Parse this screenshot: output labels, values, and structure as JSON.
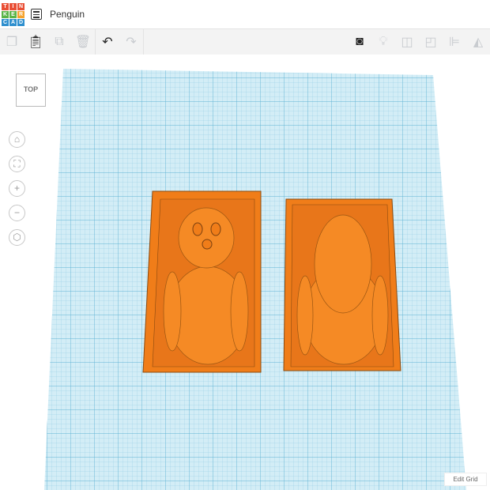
{
  "app": {
    "logo_letters": [
      "T",
      "I",
      "N",
      "K",
      "E",
      "R",
      "C",
      "A",
      "D"
    ],
    "logo_colors": [
      "#e94f35",
      "#e94f35",
      "#e94f35",
      "#5ab448",
      "#5ab448",
      "#f4a22d",
      "#2e8fce",
      "#2e8fce",
      "#2e8fce"
    ],
    "title": "Penguin"
  },
  "toolbar": {
    "left": [
      {
        "icon": "copy-icon",
        "label": "Copy"
      },
      {
        "icon": "paste-icon",
        "label": "Paste"
      },
      {
        "icon": "duplicate-icon",
        "label": "Duplicate"
      },
      {
        "icon": "delete-icon",
        "label": "Delete"
      },
      {
        "icon": "undo-icon",
        "label": "Undo"
      },
      {
        "icon": "redo-icon",
        "label": "Redo"
      }
    ],
    "right": [
      {
        "icon": "note-icon"
      },
      {
        "icon": "lightbulb-icon"
      },
      {
        "icon": "group-icon"
      },
      {
        "icon": "ungroup-icon"
      },
      {
        "icon": "align-icon"
      },
      {
        "icon": "mirror-icon"
      }
    ]
  },
  "view": {
    "cube_label": "TOP",
    "controls": [
      "home-icon",
      "fit-icon",
      "zoom-in-icon",
      "zoom-out-icon",
      "perspective-icon"
    ]
  },
  "footer": {
    "edit_grid": "Edit Grid"
  },
  "colors": {
    "workplane": "#c7e7f2",
    "grid": "#7cc3de",
    "shape": "#f07d19",
    "shape_dark": "#c45f0d"
  }
}
